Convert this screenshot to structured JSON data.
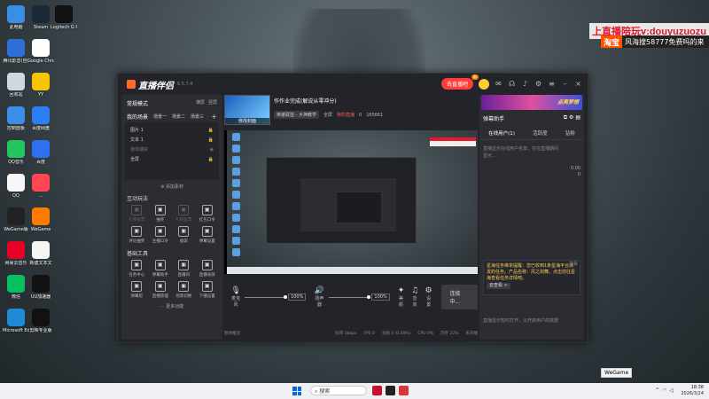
{
  "desktop": {
    "icons": [
      {
        "label": "此电脑",
        "icon": "computer-icon",
        "color": "#3a8ee6"
      },
      {
        "label": "Steam",
        "icon": "steam-icon",
        "color": "#1b2838"
      },
      {
        "label": "Logitech G HUB",
        "icon": "logitech-icon",
        "color": "#111111"
      },
      {
        "label": "腾讯影音(自)",
        "icon": "video-icon",
        "color": "#2e6fd8"
      },
      {
        "label": "Google Chrome",
        "icon": "chrome-icon",
        "color": "#ffffff"
      },
      {
        "label": "回收站",
        "icon": "recycle-bin-icon",
        "color": "#cfd8e0"
      },
      {
        "label": "YY",
        "icon": "yy-icon",
        "color": "#f7c400"
      },
      {
        "label": "控制面板",
        "icon": "control-panel-icon",
        "color": "#3a8ee6"
      },
      {
        "label": "百度网盘",
        "icon": "baidu-netdisk-icon",
        "color": "#2a7ff5"
      },
      {
        "label": "QQ音乐",
        "icon": "qq-music-icon",
        "color": "#22c55e"
      },
      {
        "label": "百度",
        "icon": "baidu-icon",
        "color": "#2f6ff0"
      },
      {
        "label": "QQ",
        "icon": "qq-icon",
        "color": "#f7f7f7"
      },
      {
        "label": "...",
        "icon": "valorant-icon",
        "color": "#ff4655"
      },
      {
        "label": "WeGame版",
        "icon": "wegame-icon",
        "color": "#222222"
      },
      {
        "label": "WeGame",
        "icon": "wegame-icon",
        "color": "#ff7a00"
      },
      {
        "label": "网易云音乐",
        "icon": "netease-music-icon",
        "color": "#e60026"
      },
      {
        "label": "新建文本文",
        "icon": "text-file-icon",
        "color": "#f5f5f5"
      },
      {
        "label": "微信",
        "icon": "wechat-icon",
        "color": "#07c160"
      },
      {
        "label": "UU加速器",
        "icon": "uu-icon",
        "color": "#111111"
      },
      {
        "label": "Microsoft Edge",
        "icon": "edge-icon",
        "color": "#1f8ad6"
      },
      {
        "label": "剪映专业版",
        "icon": "capcut-icon",
        "color": "#111111"
      }
    ]
  },
  "overlay_ad": {
    "line1": "上直播陪玩v:douyuzuozu",
    "line2_tag": "淘宝",
    "line2_text": "风海搜58777免费吗的来"
  },
  "app": {
    "name": "直播伴侣",
    "version": "6.5.7.4",
    "live_button": "去直播吧",
    "left": {
      "mode_label": "常规模式",
      "mode_opts": [
        "横屏",
        "竖屏"
      ],
      "scenes_label": "我的场景",
      "scene_tabs": [
        "场景一",
        "场景二",
        "场景三"
      ],
      "sources": [
        "图片 1",
        "文本 1",
        "游戏捕获",
        "全屏"
      ],
      "add_source": "添加素材",
      "interact_title": "互动玩法",
      "interact": [
        {
          "label": "礼物投票",
          "icon": "gift-vote-icon",
          "dim": true
        },
        {
          "label": "抽奖",
          "icon": "lottery-icon",
          "dim": false
        },
        {
          "label": "礼物投票",
          "icon": "gift-icon",
          "dim": true
        },
        {
          "label": "红包口令",
          "icon": "redpacket-icon",
          "dim": false
        },
        {
          "label": "评论抽奖",
          "icon": "comment-lottery-icon",
          "dim": false
        },
        {
          "label": "主播口令",
          "icon": "anchor-word-icon",
          "dim": false
        },
        {
          "label": "福袋",
          "icon": "luckybag-icon",
          "dim": false
        },
        {
          "label": "弹幕设置",
          "icon": "danmaku-setting-icon",
          "dim": false
        }
      ],
      "tools_title": "基础工具",
      "tools": [
        {
          "label": "任务中心",
          "icon": "task-center-icon"
        },
        {
          "label": "弹幕助手",
          "icon": "danmaku-helper-icon"
        },
        {
          "label": "直播间",
          "icon": "live-room-icon"
        },
        {
          "label": "直播录屏",
          "icon": "record-icon"
        },
        {
          "label": "弹幕剪",
          "icon": "clip-icon"
        },
        {
          "label": "直播管理",
          "icon": "manage-icon"
        },
        {
          "label": "场景切换",
          "icon": "scene-switch-icon"
        },
        {
          "label": "下播设置",
          "icon": "end-live-icon"
        }
      ],
      "more": "更多功能"
    },
    "center": {
      "cover_label": "修改封面",
      "stream_title": "作作业完成(解说从零冲分)",
      "category": "英雄联盟 - 大神教学",
      "meta_full": "全屏",
      "meta_red": "我的直播",
      "likes": "0",
      "viewers": "165661",
      "mic_label": "麦克风",
      "mic_pct": "100%",
      "speaker_label": "扬声器",
      "speaker_pct": "100%",
      "beauty": "美颜",
      "effects": "音效",
      "settings": "设置",
      "connect": "连接中...",
      "status_left": "暂停推流",
      "status_items": [
        "码率 0kbps",
        "FPS 0",
        "丢帧 0 (0.00%)",
        "CPU 0%",
        "内存 22%",
        "未开播"
      ]
    },
    "right": {
      "banner_text": "点亮梦想",
      "title": "弹幕助手",
      "tabs": [
        "在线用户(1)",
        "活跃度",
        "钻粉"
      ],
      "empty_text": "直播显示在线用户名单，仅在直播期间显示...",
      "stat1": "0.00",
      "stat2": "0",
      "notice": "星海任务维单提醒：您已收到1条星海平台派发的任务。产品名称：风之剑舞。点击前往星海查看任务详情吧。",
      "notice_btn": "去查看 >",
      "notice_tag": "弹幕",
      "footer": "直播显示暂时打开，以开启用户的数据"
    }
  },
  "tooltip": "WeGame",
  "taskbar": {
    "search": "搜索",
    "time": "18:38",
    "date": "2026/3/24"
  }
}
